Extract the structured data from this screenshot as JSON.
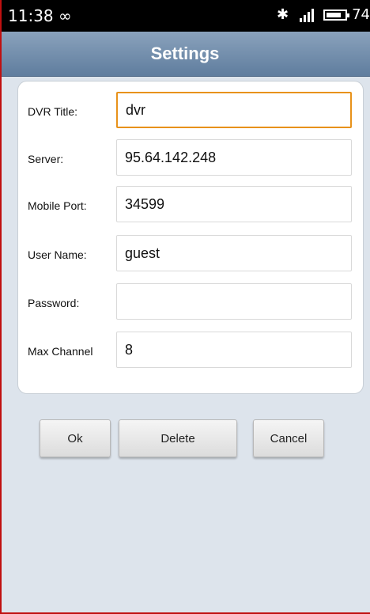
{
  "status_bar": {
    "time": "11:38",
    "infinity_symbol": "∞",
    "bluetooth_symbol": "✱",
    "battery_level": "74"
  },
  "title_bar": {
    "title": "Settings"
  },
  "form": {
    "fields": [
      {
        "label": "DVR Title:",
        "value": "dvr",
        "focused": true
      },
      {
        "label": "Server:",
        "value": "95.64.142.248"
      },
      {
        "label": "Mobile Port:",
        "value": "34599"
      },
      {
        "label": "User Name:",
        "value": "guest"
      },
      {
        "label": "Password:",
        "value": ""
      },
      {
        "label": "Max Channel",
        "value": "8"
      }
    ]
  },
  "buttons": {
    "ok_label": "Ok",
    "delete_label": "Delete",
    "cancel_label": "Cancel"
  },
  "colors": {
    "title_bar": "#6f8cab",
    "focus_border": "#e8921a",
    "background": "#dde4ec"
  }
}
